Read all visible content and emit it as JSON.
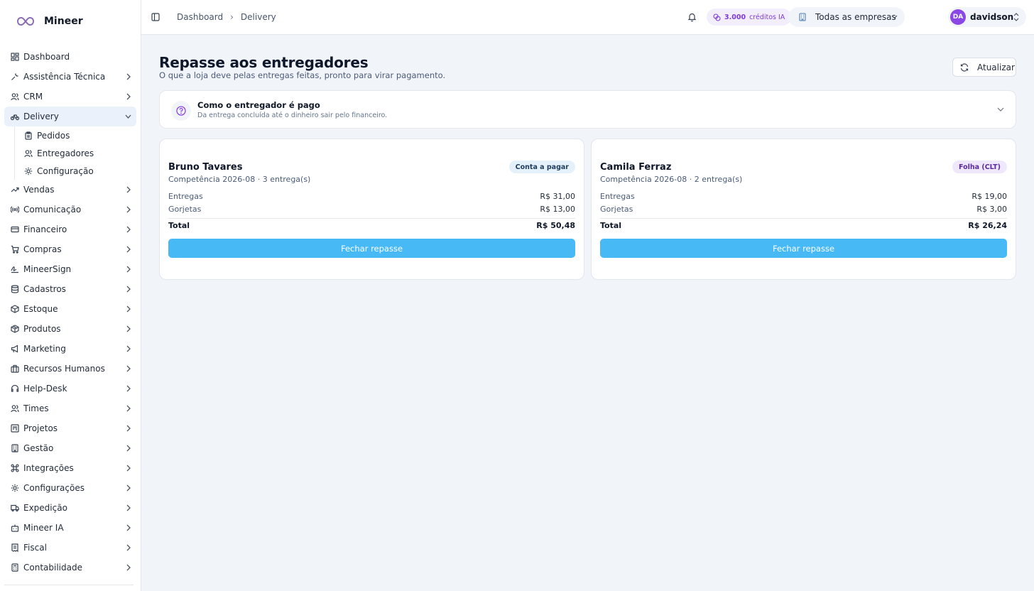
{
  "brand": {
    "name": "Mineer"
  },
  "sidebar": {
    "items": [
      {
        "label": "Dashboard",
        "icon": "dashboard-icon"
      },
      {
        "label": "Assistência Técnica",
        "icon": "wrench-icon"
      },
      {
        "label": "CRM",
        "icon": "users-icon"
      },
      {
        "label": "Delivery",
        "icon": "bike-icon",
        "expanded": true,
        "children": [
          {
            "label": "Pedidos",
            "icon": "clipboard-icon"
          },
          {
            "label": "Entregadores",
            "icon": "users-icon"
          },
          {
            "label": "Configuração",
            "icon": "gear-icon"
          }
        ]
      },
      {
        "label": "Vendas",
        "icon": "trending-up-icon"
      },
      {
        "label": "Comunicação",
        "icon": "radio-icon"
      },
      {
        "label": "Financeiro",
        "icon": "credit-card-icon"
      },
      {
        "label": "Compras",
        "icon": "cart-icon"
      },
      {
        "label": "MineerSign",
        "icon": "signature-icon"
      },
      {
        "label": "Cadastros",
        "icon": "database-icon"
      },
      {
        "label": "Estoque",
        "icon": "box-icon"
      },
      {
        "label": "Produtos",
        "icon": "package-icon"
      },
      {
        "label": "Marketing",
        "icon": "megaphone-icon"
      },
      {
        "label": "Recursos Humanos",
        "icon": "building-icon"
      },
      {
        "label": "Help-Desk",
        "icon": "headset-icon"
      },
      {
        "label": "Times",
        "icon": "team-icon"
      },
      {
        "label": "Projetos",
        "icon": "kanban-icon"
      },
      {
        "label": "Gestão",
        "icon": "office-icon"
      },
      {
        "label": "Integrações",
        "icon": "command-icon"
      },
      {
        "label": "Configurações",
        "icon": "settings-icon"
      },
      {
        "label": "Expedição",
        "icon": "truck-icon"
      },
      {
        "label": "Mineer IA",
        "icon": "bot-icon"
      },
      {
        "label": "Fiscal",
        "icon": "receipt-icon"
      },
      {
        "label": "Contabilidade",
        "icon": "calculator-icon"
      }
    ]
  },
  "topbar": {
    "breadcrumb": [
      "Dashboard",
      "Delivery"
    ],
    "credits_value": "3.000",
    "credits_label": "créditos IA",
    "company": "Todas as empresas",
    "user_initials": "DA",
    "user_name": "davidson"
  },
  "page": {
    "title": "Repasse aos entregadores",
    "subtitle": "O que a loja deve pelas entregas feitas, pronto para virar pagamento.",
    "refresh_label": "Atualizar"
  },
  "info": {
    "title": "Como o entregador é pago",
    "subtitle": "Da entrega concluída até o dinheiro sair pelo financeiro."
  },
  "cards": [
    {
      "name": "Bruno Tavares",
      "meta": "Competência 2026-08 · 3 entrega(s)",
      "badge": "Conta a pagar",
      "deliveries_label": "Entregas",
      "deliveries_value": "R$ 31,00",
      "tips_label": "Gorjetas",
      "tips_value": "R$ 13,00",
      "total_label": "Total",
      "total_value": "R$ 50,48",
      "button": "Fechar repasse"
    },
    {
      "name": "Camila Ferraz",
      "meta": "Competência 2026-08 · 2 entrega(s)",
      "badge": "Folha (CLT)",
      "deliveries_label": "Entregas",
      "deliveries_value": "R$ 19,00",
      "tips_label": "Gorjetas",
      "tips_value": "R$ 3,00",
      "total_label": "Total",
      "total_value": "R$ 26,24",
      "button": "Fechar repasse"
    }
  ],
  "colors": {
    "accent": "#47b9f5",
    "active_nav": "#eaf1fb",
    "credits": "#7e3bd6",
    "avatar": "#8b46e6"
  }
}
